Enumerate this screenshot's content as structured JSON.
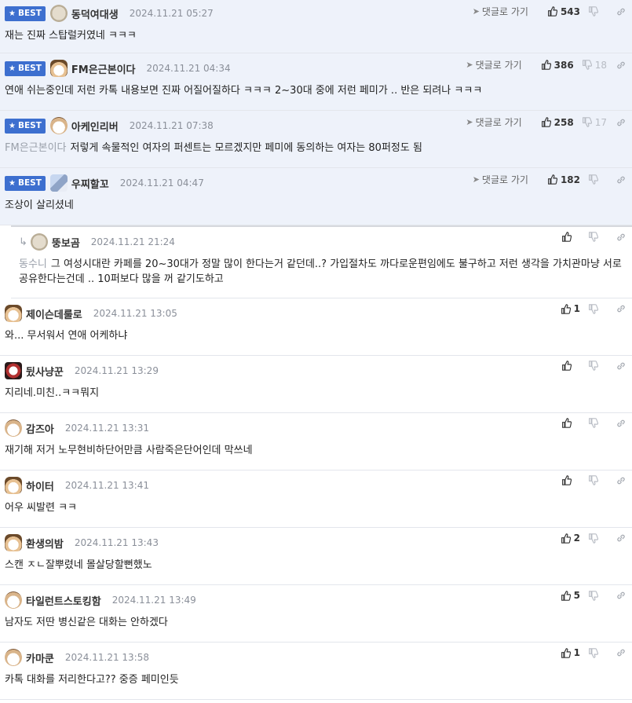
{
  "ui": {
    "best_label": "BEST",
    "reply_link_label": "댓글로 가기"
  },
  "colors": {
    "best_bg": "#eef2fa",
    "best_badge": "#3d6fcf",
    "divider": "#e3e6ec"
  },
  "comments": [
    {
      "type": "best",
      "avatar": "blob",
      "nick": "동덕여대생",
      "date": "2024.11.21 05:27",
      "text": "재는 진짜 스탑럴커였네 ㅋㅋㅋ",
      "up": "543",
      "down": ""
    },
    {
      "type": "best",
      "avatar": "fox",
      "nick": "FM은근본이다",
      "date": "2024.11.21 04:34",
      "text": "연애 쉬는중인데 저런 카톡 내용보면 진짜 어질어질하다 ㅋㅋㅋ 2~30대 중에 저런 페미가 .. 반은 되려나 ㅋㅋㅋ",
      "up": "386",
      "down": "18"
    },
    {
      "type": "best",
      "avatar": "dog",
      "nick": "아케인리버",
      "date": "2024.11.21 07:38",
      "mention": "FM은근본이다",
      "text": "저렇게 속물적인 여자의 퍼센트는 모르겠지만 페미에 동의하는 여자는 80퍼정도 됨",
      "up": "258",
      "down": "17"
    },
    {
      "type": "best",
      "avatar": "mixed",
      "nick": "우찌할꼬",
      "date": "2024.11.21 04:47",
      "text": "조상이 살리셨네",
      "up": "182",
      "down": ""
    },
    {
      "type": "reply",
      "avatar": "blob",
      "nick": "뚱보곰",
      "date": "2024.11.21 21:24",
      "mention": "동수니",
      "text": "그 여성시대란 카페를 20~30대가 정말 많이 한다는거 같던데..? 가입절차도 까다로운편임에도 불구하고 저런 생각을 가치관마냥 서로 공유한다는건데 .. 10퍼보다 많을 꺼 같기도하고",
      "up": "",
      "down": ""
    },
    {
      "type": "normal",
      "avatar": "fox",
      "nick": "제이슨데룰로",
      "date": "2024.11.21 13:05",
      "text": "와... 무서워서 연애 어케하냐",
      "up": "1",
      "down": ""
    },
    {
      "type": "normal",
      "avatar": "red",
      "nick": "뒸사냥꾼",
      "date": "2024.11.21 13:29",
      "text": "지리네.미친..ㅋㅋ뭐지",
      "up": "",
      "down": ""
    },
    {
      "type": "normal",
      "avatar": "dog",
      "nick": "감즈아",
      "date": "2024.11.21 13:31",
      "text": "재기해 저거 노무현비하단어만큼 사람죽은단어인데 막쓰네",
      "up": "",
      "down": ""
    },
    {
      "type": "normal",
      "avatar": "fox",
      "nick": "하이터",
      "date": "2024.11.21 13:41",
      "text": "어우 씨발련 ㅋㅋ",
      "up": "",
      "down": ""
    },
    {
      "type": "normal",
      "avatar": "fox",
      "nick": "환생의밤",
      "date": "2024.11.21 13:43",
      "text": "스캔 ㅈㄴ잘뿌렸네 몰살당할뻔했노",
      "up": "2",
      "down": ""
    },
    {
      "type": "normal",
      "avatar": "dog",
      "nick": "타일런트스토킹함",
      "date": "2024.11.21 13:49",
      "text": "남자도 저딴 병신같은 대화는 안하겠다",
      "up": "5",
      "down": ""
    },
    {
      "type": "normal",
      "avatar": "dog",
      "nick": "카마쿤",
      "date": "2024.11.21 13:58",
      "text": "카톡 대화를 저리한다고?? 중증 페미인듯",
      "up": "1",
      "down": ""
    }
  ]
}
